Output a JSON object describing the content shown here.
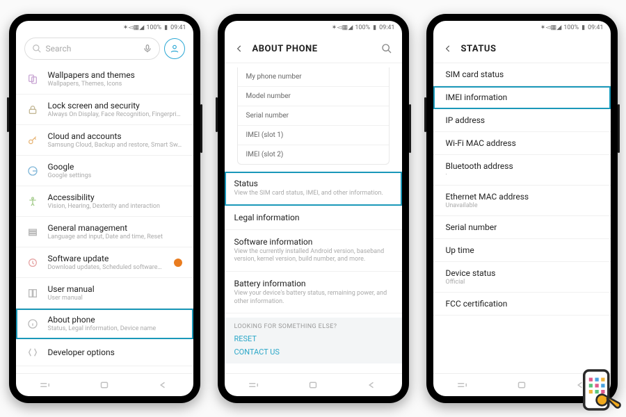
{
  "statusbar": {
    "battery": "100%",
    "time": "09:41"
  },
  "phone1": {
    "search_placeholder": "Search",
    "items": [
      {
        "title": "Wallpapers and themes",
        "sub": "Wallpapers, Themes, Icons"
      },
      {
        "title": "Lock screen and security",
        "sub": "Always On Display, Face Recognition, Fingerpri…"
      },
      {
        "title": "Cloud and accounts",
        "sub": "Samsung Cloud, Backup and restore, Smart Sw…"
      },
      {
        "title": "Google",
        "sub": "Google settings"
      },
      {
        "title": "Accessibility",
        "sub": "Vision, Hearing, Dexterity and interaction"
      },
      {
        "title": "General management",
        "sub": "Language and input, Date and time, Reset"
      },
      {
        "title": "Software update",
        "sub": "Download updates, Scheduled software…"
      },
      {
        "title": "User manual",
        "sub": "User manual"
      },
      {
        "title": "About phone",
        "sub": "Status, Legal information, Device name"
      },
      {
        "title": "Developer options",
        "sub": ""
      }
    ]
  },
  "phone2": {
    "header": "ABOUT PHONE",
    "spec": [
      "My phone number",
      "Model number",
      "Serial number",
      "IMEI (slot 1)",
      "IMEI (slot 2)"
    ],
    "sections": [
      {
        "title": "Status",
        "sub": "View the SIM card status, IMEI, and other information."
      },
      {
        "title": "Legal information",
        "sub": ""
      },
      {
        "title": "Software information",
        "sub": "View the currently installed Android version, baseband version, kernel version, build number, and more."
      },
      {
        "title": "Battery information",
        "sub": "View your device's battery status, remaining power, and other information."
      }
    ],
    "looking": {
      "label": "LOOKING FOR SOMETHING ELSE?",
      "reset": "RESET",
      "contact": "CONTACT US"
    }
  },
  "phone3": {
    "header": "STATUS",
    "items": [
      {
        "title": "SIM card status",
        "sub": ""
      },
      {
        "title": "IMEI information",
        "sub": ""
      },
      {
        "title": "IP address",
        "sub": ""
      },
      {
        "title": "Wi-Fi MAC address",
        "sub": ""
      },
      {
        "title": "Bluetooth address",
        "sub": "·"
      },
      {
        "title": "Ethernet MAC address",
        "sub": "Unavailable"
      },
      {
        "title": "Serial number",
        "sub": ""
      },
      {
        "title": "Up time",
        "sub": ""
      },
      {
        "title": "Device status",
        "sub": "Official"
      },
      {
        "title": "FCC certification",
        "sub": ""
      }
    ]
  }
}
